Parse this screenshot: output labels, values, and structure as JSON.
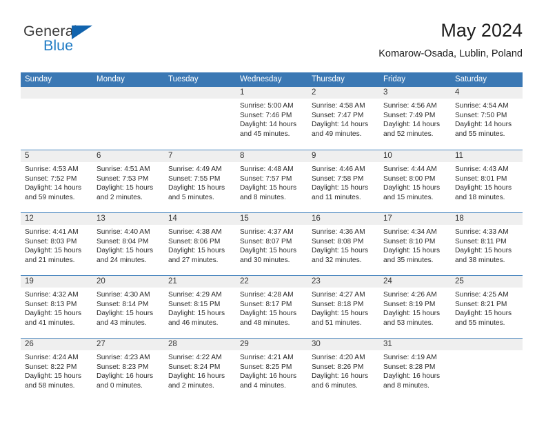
{
  "brand": {
    "name_part1": "General",
    "name_part2": "Blue",
    "triangle_icon": "triangle-icon",
    "accent_color": "#1f7bc4",
    "triangle_color": "#1163ad"
  },
  "header": {
    "title": "May 2024",
    "location": "Komarow-Osada, Lublin, Poland"
  },
  "theme": {
    "header_row_bg": "#3b78b4",
    "header_row_text": "#ffffff",
    "date_band_bg": "#efefef",
    "row_divider": "#4a87bf"
  },
  "weekdays": [
    "Sunday",
    "Monday",
    "Tuesday",
    "Wednesday",
    "Thursday",
    "Friday",
    "Saturday"
  ],
  "weeks": [
    [
      {
        "date": "",
        "sunrise": "",
        "sunset": "",
        "daylight_line1": "",
        "daylight_line2": "",
        "empty": true
      },
      {
        "date": "",
        "sunrise": "",
        "sunset": "",
        "daylight_line1": "",
        "daylight_line2": "",
        "empty": true
      },
      {
        "date": "",
        "sunrise": "",
        "sunset": "",
        "daylight_line1": "",
        "daylight_line2": "",
        "empty": true
      },
      {
        "date": "1",
        "sunrise": "Sunrise: 5:00 AM",
        "sunset": "Sunset: 7:46 PM",
        "daylight_line1": "Daylight: 14 hours",
        "daylight_line2": "and 45 minutes."
      },
      {
        "date": "2",
        "sunrise": "Sunrise: 4:58 AM",
        "sunset": "Sunset: 7:47 PM",
        "daylight_line1": "Daylight: 14 hours",
        "daylight_line2": "and 49 minutes."
      },
      {
        "date": "3",
        "sunrise": "Sunrise: 4:56 AM",
        "sunset": "Sunset: 7:49 PM",
        "daylight_line1": "Daylight: 14 hours",
        "daylight_line2": "and 52 minutes."
      },
      {
        "date": "4",
        "sunrise": "Sunrise: 4:54 AM",
        "sunset": "Sunset: 7:50 PM",
        "daylight_line1": "Daylight: 14 hours",
        "daylight_line2": "and 55 minutes."
      }
    ],
    [
      {
        "date": "5",
        "sunrise": "Sunrise: 4:53 AM",
        "sunset": "Sunset: 7:52 PM",
        "daylight_line1": "Daylight: 14 hours",
        "daylight_line2": "and 59 minutes."
      },
      {
        "date": "6",
        "sunrise": "Sunrise: 4:51 AM",
        "sunset": "Sunset: 7:53 PM",
        "daylight_line1": "Daylight: 15 hours",
        "daylight_line2": "and 2 minutes."
      },
      {
        "date": "7",
        "sunrise": "Sunrise: 4:49 AM",
        "sunset": "Sunset: 7:55 PM",
        "daylight_line1": "Daylight: 15 hours",
        "daylight_line2": "and 5 minutes."
      },
      {
        "date": "8",
        "sunrise": "Sunrise: 4:48 AM",
        "sunset": "Sunset: 7:57 PM",
        "daylight_line1": "Daylight: 15 hours",
        "daylight_line2": "and 8 minutes."
      },
      {
        "date": "9",
        "sunrise": "Sunrise: 4:46 AM",
        "sunset": "Sunset: 7:58 PM",
        "daylight_line1": "Daylight: 15 hours",
        "daylight_line2": "and 11 minutes."
      },
      {
        "date": "10",
        "sunrise": "Sunrise: 4:44 AM",
        "sunset": "Sunset: 8:00 PM",
        "daylight_line1": "Daylight: 15 hours",
        "daylight_line2": "and 15 minutes."
      },
      {
        "date": "11",
        "sunrise": "Sunrise: 4:43 AM",
        "sunset": "Sunset: 8:01 PM",
        "daylight_line1": "Daylight: 15 hours",
        "daylight_line2": "and 18 minutes."
      }
    ],
    [
      {
        "date": "12",
        "sunrise": "Sunrise: 4:41 AM",
        "sunset": "Sunset: 8:03 PM",
        "daylight_line1": "Daylight: 15 hours",
        "daylight_line2": "and 21 minutes."
      },
      {
        "date": "13",
        "sunrise": "Sunrise: 4:40 AM",
        "sunset": "Sunset: 8:04 PM",
        "daylight_line1": "Daylight: 15 hours",
        "daylight_line2": "and 24 minutes."
      },
      {
        "date": "14",
        "sunrise": "Sunrise: 4:38 AM",
        "sunset": "Sunset: 8:06 PM",
        "daylight_line1": "Daylight: 15 hours",
        "daylight_line2": "and 27 minutes."
      },
      {
        "date": "15",
        "sunrise": "Sunrise: 4:37 AM",
        "sunset": "Sunset: 8:07 PM",
        "daylight_line1": "Daylight: 15 hours",
        "daylight_line2": "and 30 minutes."
      },
      {
        "date": "16",
        "sunrise": "Sunrise: 4:36 AM",
        "sunset": "Sunset: 8:08 PM",
        "daylight_line1": "Daylight: 15 hours",
        "daylight_line2": "and 32 minutes."
      },
      {
        "date": "17",
        "sunrise": "Sunrise: 4:34 AM",
        "sunset": "Sunset: 8:10 PM",
        "daylight_line1": "Daylight: 15 hours",
        "daylight_line2": "and 35 minutes."
      },
      {
        "date": "18",
        "sunrise": "Sunrise: 4:33 AM",
        "sunset": "Sunset: 8:11 PM",
        "daylight_line1": "Daylight: 15 hours",
        "daylight_line2": "and 38 minutes."
      }
    ],
    [
      {
        "date": "19",
        "sunrise": "Sunrise: 4:32 AM",
        "sunset": "Sunset: 8:13 PM",
        "daylight_line1": "Daylight: 15 hours",
        "daylight_line2": "and 41 minutes."
      },
      {
        "date": "20",
        "sunrise": "Sunrise: 4:30 AM",
        "sunset": "Sunset: 8:14 PM",
        "daylight_line1": "Daylight: 15 hours",
        "daylight_line2": "and 43 minutes."
      },
      {
        "date": "21",
        "sunrise": "Sunrise: 4:29 AM",
        "sunset": "Sunset: 8:15 PM",
        "daylight_line1": "Daylight: 15 hours",
        "daylight_line2": "and 46 minutes."
      },
      {
        "date": "22",
        "sunrise": "Sunrise: 4:28 AM",
        "sunset": "Sunset: 8:17 PM",
        "daylight_line1": "Daylight: 15 hours",
        "daylight_line2": "and 48 minutes."
      },
      {
        "date": "23",
        "sunrise": "Sunrise: 4:27 AM",
        "sunset": "Sunset: 8:18 PM",
        "daylight_line1": "Daylight: 15 hours",
        "daylight_line2": "and 51 minutes."
      },
      {
        "date": "24",
        "sunrise": "Sunrise: 4:26 AM",
        "sunset": "Sunset: 8:19 PM",
        "daylight_line1": "Daylight: 15 hours",
        "daylight_line2": "and 53 minutes."
      },
      {
        "date": "25",
        "sunrise": "Sunrise: 4:25 AM",
        "sunset": "Sunset: 8:21 PM",
        "daylight_line1": "Daylight: 15 hours",
        "daylight_line2": "and 55 minutes."
      }
    ],
    [
      {
        "date": "26",
        "sunrise": "Sunrise: 4:24 AM",
        "sunset": "Sunset: 8:22 PM",
        "daylight_line1": "Daylight: 15 hours",
        "daylight_line2": "and 58 minutes."
      },
      {
        "date": "27",
        "sunrise": "Sunrise: 4:23 AM",
        "sunset": "Sunset: 8:23 PM",
        "daylight_line1": "Daylight: 16 hours",
        "daylight_line2": "and 0 minutes."
      },
      {
        "date": "28",
        "sunrise": "Sunrise: 4:22 AM",
        "sunset": "Sunset: 8:24 PM",
        "daylight_line1": "Daylight: 16 hours",
        "daylight_line2": "and 2 minutes."
      },
      {
        "date": "29",
        "sunrise": "Sunrise: 4:21 AM",
        "sunset": "Sunset: 8:25 PM",
        "daylight_line1": "Daylight: 16 hours",
        "daylight_line2": "and 4 minutes."
      },
      {
        "date": "30",
        "sunrise": "Sunrise: 4:20 AM",
        "sunset": "Sunset: 8:26 PM",
        "daylight_line1": "Daylight: 16 hours",
        "daylight_line2": "and 6 minutes."
      },
      {
        "date": "31",
        "sunrise": "Sunrise: 4:19 AM",
        "sunset": "Sunset: 8:28 PM",
        "daylight_line1": "Daylight: 16 hours",
        "daylight_line2": "and 8 minutes."
      },
      {
        "date": "",
        "sunrise": "",
        "sunset": "",
        "daylight_line1": "",
        "daylight_line2": "",
        "empty": true
      }
    ]
  ]
}
